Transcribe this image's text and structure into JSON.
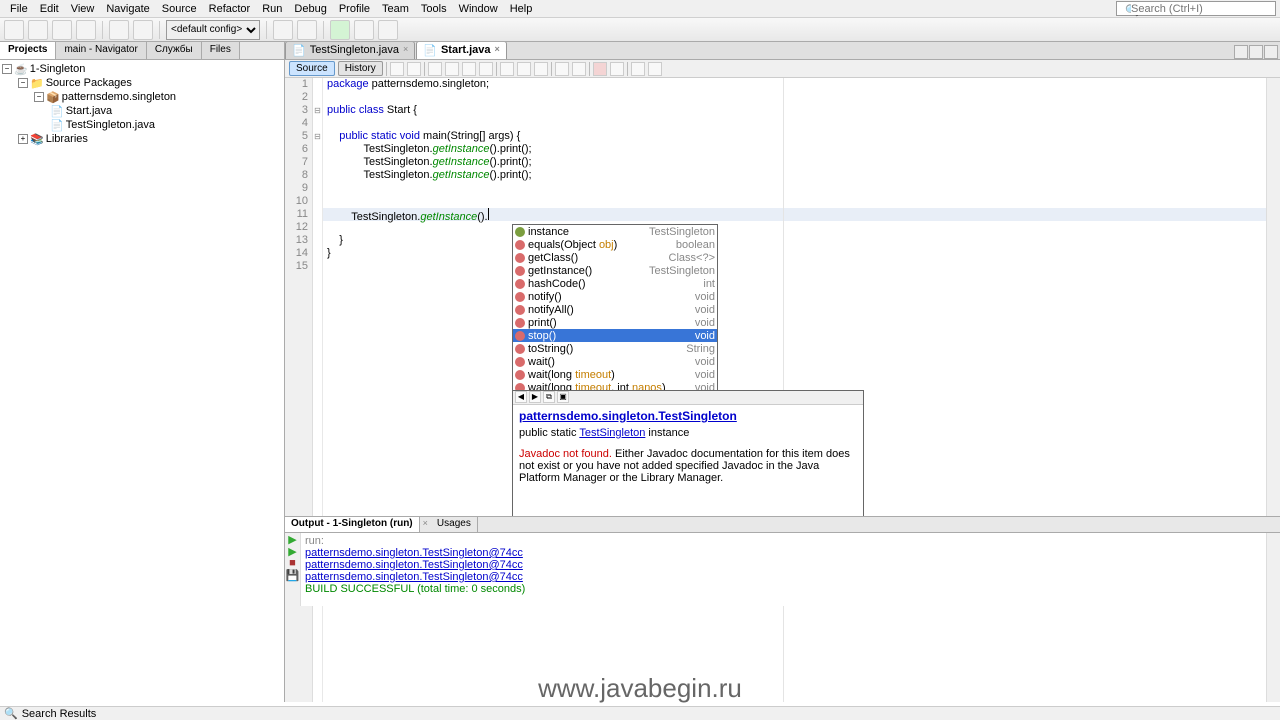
{
  "menu": [
    "File",
    "Edit",
    "View",
    "Navigate",
    "Source",
    "Refactor",
    "Run",
    "Debug",
    "Profile",
    "Team",
    "Tools",
    "Window",
    "Help"
  ],
  "search": {
    "placeholder": "Search (Ctrl+I)"
  },
  "config": "<default config>",
  "left_tabs": [
    "Projects",
    "main - Navigator",
    "Службы",
    "Files"
  ],
  "tree": {
    "root": "1-Singleton",
    "pkg_root": "Source Packages",
    "pkg": "patternsdemo.singleton",
    "files": [
      "Start.java",
      "TestSingleton.java"
    ],
    "libs": "Libraries"
  },
  "editor_tabs": [
    {
      "label": "TestSingleton.java",
      "active": false
    },
    {
      "label": "Start.java",
      "active": true
    }
  ],
  "editor_modes": [
    "Source",
    "History"
  ],
  "code": {
    "l1": "package patternsdemo.singleton;",
    "l3": "public class Start {",
    "l5": "    public static void main(String[] args) {",
    "l6": "            TestSingleton.getInstance().print();",
    "l7": "            TestSingleton.getInstance().print();",
    "l8": "            TestSingleton.getInstance().print();",
    "l11": "        TestSingleton.getInstance().",
    "l13": "    }",
    "l14": "}"
  },
  "autocomplete": [
    {
      "name": "instance",
      "type": "TestSingleton",
      "kind": "field"
    },
    {
      "name": "equals(Object obj)",
      "type": "boolean",
      "kind": "method",
      "param": "obj"
    },
    {
      "name": "getClass()",
      "type": "Class<?>",
      "kind": "method"
    },
    {
      "name": "getInstance()",
      "type": "TestSingleton",
      "kind": "method"
    },
    {
      "name": "hashCode()",
      "type": "int",
      "kind": "method"
    },
    {
      "name": "notify()",
      "type": "void",
      "kind": "method"
    },
    {
      "name": "notifyAll()",
      "type": "void",
      "kind": "method"
    },
    {
      "name": "print()",
      "type": "void",
      "kind": "method"
    },
    {
      "name": "stop()",
      "type": "void",
      "kind": "method",
      "selected": true
    },
    {
      "name": "toString()",
      "type": "String",
      "kind": "method"
    },
    {
      "name": "wait()",
      "type": "void",
      "kind": "method"
    },
    {
      "name": "wait(long timeout)",
      "type": "void",
      "kind": "method",
      "param": "timeout"
    },
    {
      "name": "wait(long timeout, int nanos)",
      "type": "void",
      "kind": "method",
      "params": true
    }
  ],
  "javadoc": {
    "title": "patternsdemo.singleton.TestSingleton",
    "sig_pre": "public static ",
    "sig_link": "TestSingleton",
    "sig_post": " instance",
    "err_prefix": "Javadoc not found.",
    "err_text": " Either Javadoc documentation for this item does not exist or you have not added specified Javadoc in the Java Platform Manager or the Library Manager."
  },
  "output": {
    "tabs": [
      "Output - 1-Singleton (run)",
      "Usages"
    ],
    "lines": [
      "run:",
      "patternsdemo.singleton.TestSingleton@74cc",
      "patternsdemo.singleton.TestSingleton@74cc",
      "patternsdemo.singleton.TestSingleton@74cc"
    ],
    "build": "BUILD SUCCESSFUL (total time: 0 seconds)"
  },
  "status": "Search Results",
  "watermark": "www.javabegin.ru"
}
